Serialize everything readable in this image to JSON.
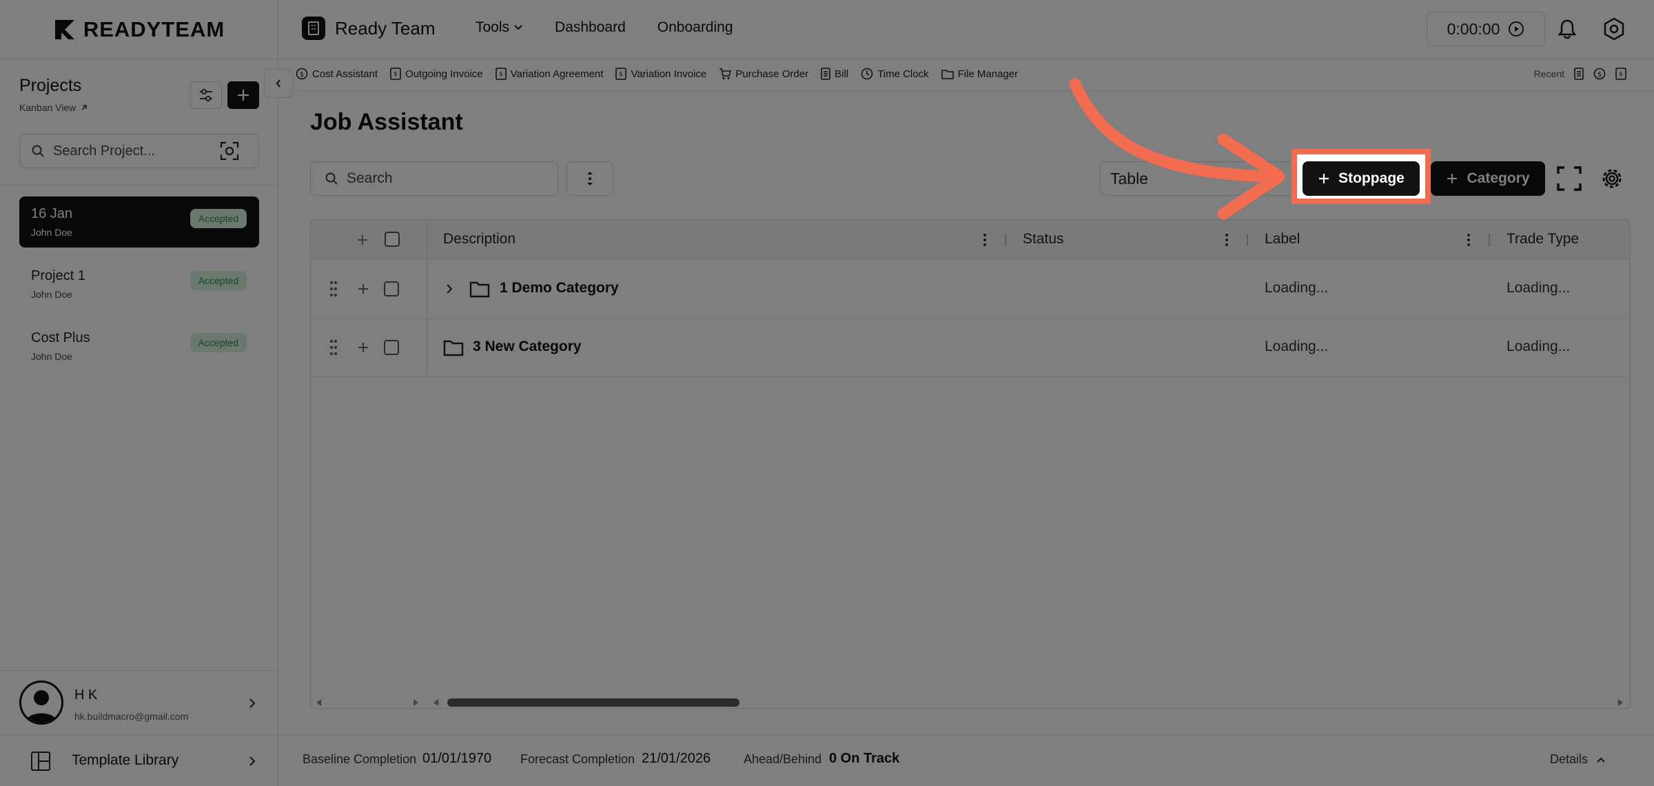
{
  "brand": {
    "name": "READYTEAM"
  },
  "header": {
    "team_name": "Ready Team",
    "nav": {
      "tools": "Tools",
      "dashboard": "Dashboard",
      "onboarding": "Onboarding"
    },
    "timer": "0:00:00"
  },
  "quickbar": {
    "items": [
      "Cost Assistant",
      "Outgoing Invoice",
      "Variation Agreement",
      "Variation Invoice",
      "Purchase Order",
      "Bill",
      "Time Clock",
      "File Manager"
    ],
    "recent_label": "Recent"
  },
  "sidebar": {
    "title": "Projects",
    "view_link": "Kanban View",
    "search_placeholder": "Search Project...",
    "projects": [
      {
        "name": "16 Jan",
        "owner": "John Doe",
        "status": "Accepted"
      },
      {
        "name": "Project 1",
        "owner": "John Doe",
        "status": "Accepted"
      },
      {
        "name": "Cost Plus",
        "owner": "John Doe",
        "status": "Accepted"
      }
    ],
    "user": {
      "name": "H K",
      "email": "hk.buildmacro@gmail.com"
    },
    "template_library": "Template Library"
  },
  "main": {
    "title": "Job Assistant",
    "search_placeholder": "Search",
    "view_select": "Table",
    "stoppage_button": "Stoppage",
    "category_button": "Category",
    "table": {
      "columns": [
        "Description",
        "Status",
        "Label",
        "Trade Type"
      ],
      "rows": [
        {
          "description": "1 Demo Category",
          "status": "",
          "label": "Loading...",
          "trade_type": "Loading...",
          "expandable": true
        },
        {
          "description": "3 New Category",
          "status": "",
          "label": "Loading...",
          "trade_type": "Loading...",
          "expandable": false
        }
      ]
    }
  },
  "footer": {
    "baseline_label": "Baseline Completion",
    "baseline_value": "01/01/1970",
    "forecast_label": "Forecast Completion",
    "forecast_value": "21/01/2026",
    "ahead_label": "Ahead/Behind",
    "ahead_value": "0 On Track",
    "details": "Details"
  },
  "colors": {
    "accent": "#f26c4f",
    "dark": "#111111",
    "badge_bg": "#d4f0db",
    "badge_text": "#2e8b4a"
  }
}
